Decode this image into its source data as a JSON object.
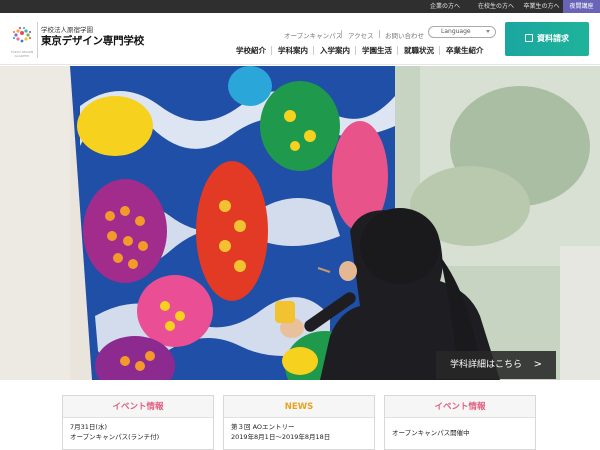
{
  "utility_bar": {
    "links": [
      "企業の方へ",
      "在校生の方へ",
      "卒業生の方へ",
      "夜間講座"
    ]
  },
  "header": {
    "logo_text_en": "TOKYO DESIGN ACADEMY",
    "corp_name": "学校法人原宿学園",
    "school_name": "東京デザイン専門学校",
    "sub_links": [
      "オープンキャンパス",
      "アクセス",
      "お問い合わせ"
    ],
    "language_label": "Language",
    "nav": [
      "学校紹介",
      "学科案内",
      "入学案内",
      "学園生活",
      "就職状況",
      "卒業生紹介"
    ],
    "request_button": "資料請求"
  },
  "hero": {
    "detail_button": "学科詳細はこちら",
    "detail_arrow": ">"
  },
  "info_boxes": [
    {
      "title": "イベント情報",
      "lines": [
        "7月31日(水)",
        "オープンキャンパス(ランチ付)"
      ]
    },
    {
      "title": "NEWS",
      "lines": [
        "第３回 AOエントリー",
        "2019年8月1日～2019年8月18日"
      ]
    },
    {
      "title": "イベント情報",
      "lines": [
        "オープンキャンパス開催中"
      ]
    }
  ],
  "colors": {
    "util_bar": "#2f2f2f",
    "util_highlight": "#6a64b8",
    "request_button": "#1aa6a0",
    "event_title": "#e0607e",
    "news_title": "#e8a321"
  }
}
